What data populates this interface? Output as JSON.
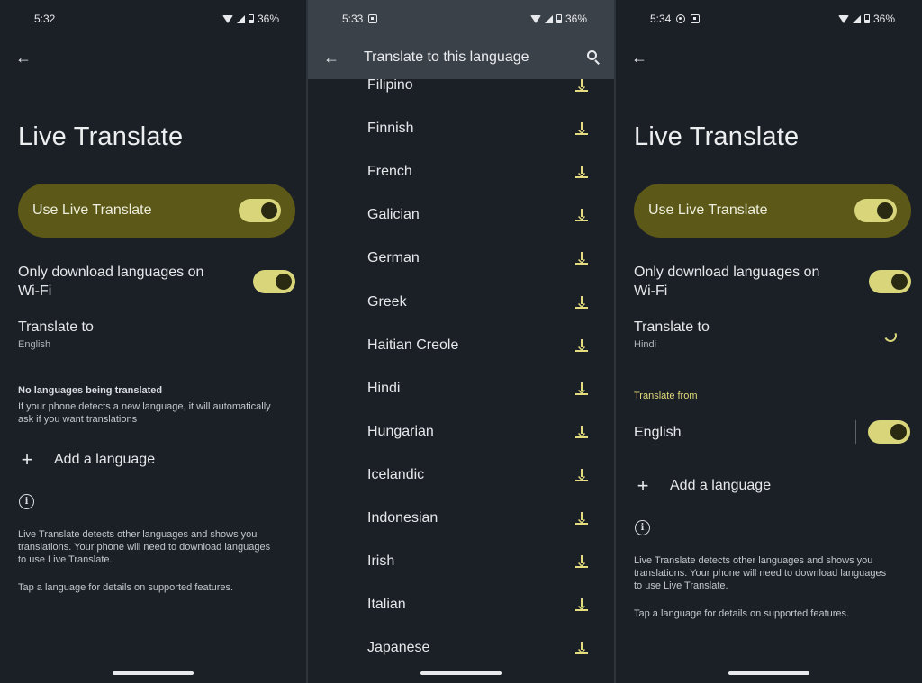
{
  "screen1": {
    "status": {
      "time": "5:32",
      "battery": "36%"
    },
    "title": "Live Translate",
    "use_toggle": {
      "label": "Use Live Translate",
      "on": true
    },
    "wifi_only": {
      "label_line1": "Only download languages on",
      "label_line2": "Wi-Fi",
      "on": true
    },
    "translate_to": {
      "label": "Translate to",
      "value": "English"
    },
    "no_languages": {
      "heading": "No languages being translated",
      "line1": "If your phone detects a new language, it will automatically",
      "line2": "ask if you want translations"
    },
    "add_language": "Add a language",
    "info": {
      "line1": "Live Translate detects other languages and shows you",
      "line2": "translations. Your phone will need to download languages",
      "line3": "to use Live Translate.",
      "tip": "Tap a language for details on supported features."
    }
  },
  "screen2": {
    "status": {
      "time": "5:33",
      "battery": "36%"
    },
    "title": "Translate to this language",
    "languages": [
      "Filipino",
      "Finnish",
      "French",
      "Galician",
      "German",
      "Greek",
      "Haitian Creole",
      "Hindi",
      "Hungarian",
      "Icelandic",
      "Indonesian",
      "Irish",
      "Italian",
      "Japanese"
    ]
  },
  "screen3": {
    "status": {
      "time": "5:34",
      "battery": "36%"
    },
    "title": "Live Translate",
    "use_toggle": {
      "label": "Use Live Translate",
      "on": true
    },
    "wifi_only": {
      "label_line1": "Only download languages on",
      "label_line2": "Wi-Fi",
      "on": true
    },
    "translate_to": {
      "label": "Translate to",
      "value": "Hindi"
    },
    "translate_from": {
      "heading": "Translate from",
      "items": [
        {
          "label": "English",
          "on": true
        }
      ]
    },
    "add_language": "Add a language",
    "info": {
      "line1": "Live Translate detects other languages and shows you",
      "line2": "translations. Your phone will need to download languages",
      "line3": "to use Live Translate.",
      "tip": "Tap a language for details on supported features."
    }
  },
  "colors": {
    "background": "#1b2026",
    "card": "#5c5817",
    "toggle_on": "#d9d57a",
    "accent": "#e5dc80",
    "appbar": "#3b4148"
  },
  "icons": [
    "back-arrow-icon",
    "search-icon",
    "download-icon",
    "plus-icon",
    "info-icon",
    "wifi-icon",
    "cellular-icon",
    "battery-icon",
    "loading-spinner-icon"
  ]
}
